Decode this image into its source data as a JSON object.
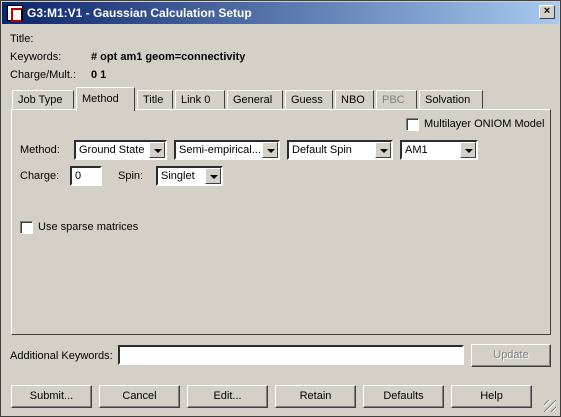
{
  "window": {
    "title": "G3:M1:V1 - Gaussian Calculation Setup",
    "close_glyph": "×"
  },
  "header": {
    "title_label": "Title:",
    "keywords_label": "Keywords:",
    "keywords_value": "# opt am1 geom=connectivity",
    "charge_mult_label": "Charge/Mult.:",
    "charge_mult_value": "0 1"
  },
  "tabs": [
    {
      "label": "Job Type",
      "active": false,
      "enabled": true
    },
    {
      "label": "Method",
      "active": true,
      "enabled": true
    },
    {
      "label": "Title",
      "active": false,
      "enabled": true
    },
    {
      "label": "Link 0",
      "active": false,
      "enabled": true
    },
    {
      "label": "General",
      "active": false,
      "enabled": true
    },
    {
      "label": "Guess",
      "active": false,
      "enabled": true
    },
    {
      "label": "NBO",
      "active": false,
      "enabled": true
    },
    {
      "label": "PBC",
      "active": false,
      "enabled": false
    },
    {
      "label": "Solvation",
      "active": false,
      "enabled": true
    }
  ],
  "method_tab": {
    "oniom_label": "Multilayer ONIOM Model",
    "oniom_checked": false,
    "method_label": "Method:",
    "state_value": "Ground State",
    "class_value": "Semi-empirical...",
    "spin_type_value": "Default Spin",
    "method_value": "AM1",
    "charge_label": "Charge:",
    "charge_value": "0",
    "spin_label": "Spin:",
    "spin_value": "Singlet",
    "sparse_label": "Use sparse matrices",
    "sparse_checked": false
  },
  "additional": {
    "label": "Additional Keywords:",
    "value": "",
    "update_label": "Update"
  },
  "buttons": {
    "submit": "Submit...",
    "cancel": "Cancel",
    "edit": "Edit...",
    "retain": "Retain",
    "defaults": "Defaults",
    "help": "Help"
  }
}
